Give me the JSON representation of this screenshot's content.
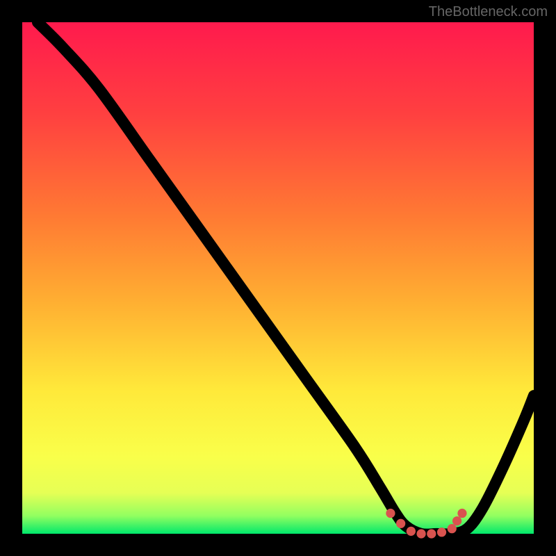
{
  "watermark": "TheBottleneck.com",
  "gradient_stops": [
    {
      "pct": 0,
      "color": "#ff1a4d"
    },
    {
      "pct": 18,
      "color": "#ff4040"
    },
    {
      "pct": 38,
      "color": "#ff7a33"
    },
    {
      "pct": 55,
      "color": "#ffb032"
    },
    {
      "pct": 72,
      "color": "#ffe93a"
    },
    {
      "pct": 85,
      "color": "#f9ff4a"
    },
    {
      "pct": 92,
      "color": "#e6ff55"
    },
    {
      "pct": 96.5,
      "color": "#92ff60"
    },
    {
      "pct": 100,
      "color": "#00e86b"
    }
  ],
  "chart_data": {
    "type": "line",
    "title": "",
    "xlabel": "",
    "ylabel": "",
    "xlim": [
      0,
      100
    ],
    "ylim": [
      0,
      100
    ],
    "grid": false,
    "legend": false,
    "series": [
      {
        "name": "bottleneck-curve",
        "x": [
          3,
          8,
          15,
          25,
          35,
          45,
          55,
          65,
          70,
          73,
          75,
          78,
          81,
          84,
          87,
          90,
          94,
          98,
          100
        ],
        "values": [
          100,
          95,
          87,
          73,
          59,
          45,
          31,
          17,
          9,
          4,
          1.5,
          0,
          0,
          0,
          1,
          5,
          13,
          22,
          27
        ]
      }
    ],
    "markers": {
      "name": "plateau-markers",
      "x": [
        72,
        74,
        76,
        78,
        80,
        82,
        84,
        85,
        86
      ],
      "values": [
        4,
        2,
        0.5,
        0,
        0,
        0.3,
        1,
        2.5,
        4
      ]
    }
  }
}
